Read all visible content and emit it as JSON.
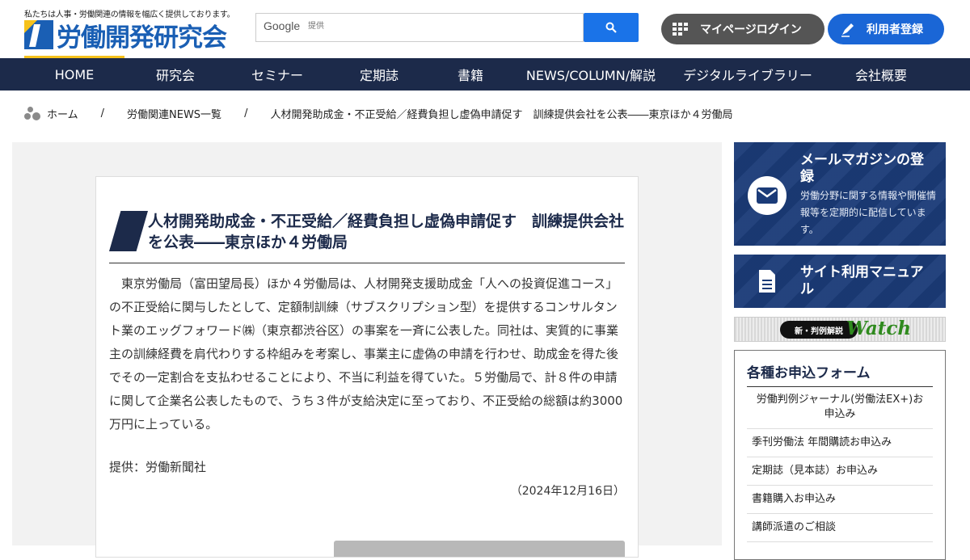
{
  "header": {
    "tagline": "私たちは人事・労働関連の情報を幅広く提供しております。",
    "logo_text": "労働開発研究会",
    "search": {
      "brand": "Google",
      "placeholder": "提供"
    },
    "mypage_label": "マイページログイン",
    "register_label": "利用者登録"
  },
  "nav": {
    "items": [
      {
        "label": "HOME",
        "active": true
      },
      {
        "label": "研究会"
      },
      {
        "label": "セミナー"
      },
      {
        "label": "定期誌"
      },
      {
        "label": "書籍"
      },
      {
        "label": "NEWS/COLUMN/解説"
      },
      {
        "label": "デジタルライブラリー"
      },
      {
        "label": "会社概要"
      }
    ]
  },
  "breadcrumb": {
    "home": "ホーム",
    "sep": "/",
    "list": "労働関連NEWS一覧",
    "current": "人材開発助成金・不正受給／経費負担し虚偽申請促す　訓練提供会社を公表――東京ほか４労働局"
  },
  "article": {
    "title": "人材開発助成金・不正受給／経費負担し虚偽申請促す　訓練提供会社を公表――東京ほか４労働局",
    "body": "東京労働局（富田望局長）ほか４労働局は、人材開発支援助成金「人への投資促進コース」の不正受給に関与したとして、定額制訓練（サブスクリプション型）を提供するコンサルタント業のエッグフォワード㈱（東京都渋谷区）の事案を一斉に公表した。同社は、実質的に事業主の訓練経費を肩代わりする枠組みを考案し、事業主に虚偽の申請を行わせ、助成金を得た後でその一定割合を支払わせることにより、不当に利益を得ていた。５労働局で、計８件の申請に関して企業名公表したもので、うち３件が支給決定に至っており、不正受給の総額は約3000万円に上っている。",
    "source": "提供：労働新聞社",
    "date": "（2024年12月16日）"
  },
  "sidebar": {
    "mail": {
      "title": "メールマガジンの登録",
      "desc": "労働分野に関する情報や開催情報等を定期的に配信しています。"
    },
    "manual": {
      "title": "サイト利用マニュアル"
    },
    "watch": {
      "pill": "新・判例解説",
      "word": "Watch"
    },
    "forms": {
      "title": "各種お申込フォーム",
      "items": [
        "労働判例ジャーナル(労働法EX+)お申込み",
        "季刊労働法 年間購読お申込み",
        "定期誌（見本誌）お申込み",
        "書籍購入お申込み",
        "講師派遣のご相談"
      ]
    }
  },
  "colors": {
    "navy": "#1c2a4a",
    "accent_yellow": "#f6c21b",
    "brand_blue": "#1a5fb4",
    "register_blue": "#1a66d6",
    "mypage_gray": "#555555",
    "search_blue": "#1a73e8"
  }
}
